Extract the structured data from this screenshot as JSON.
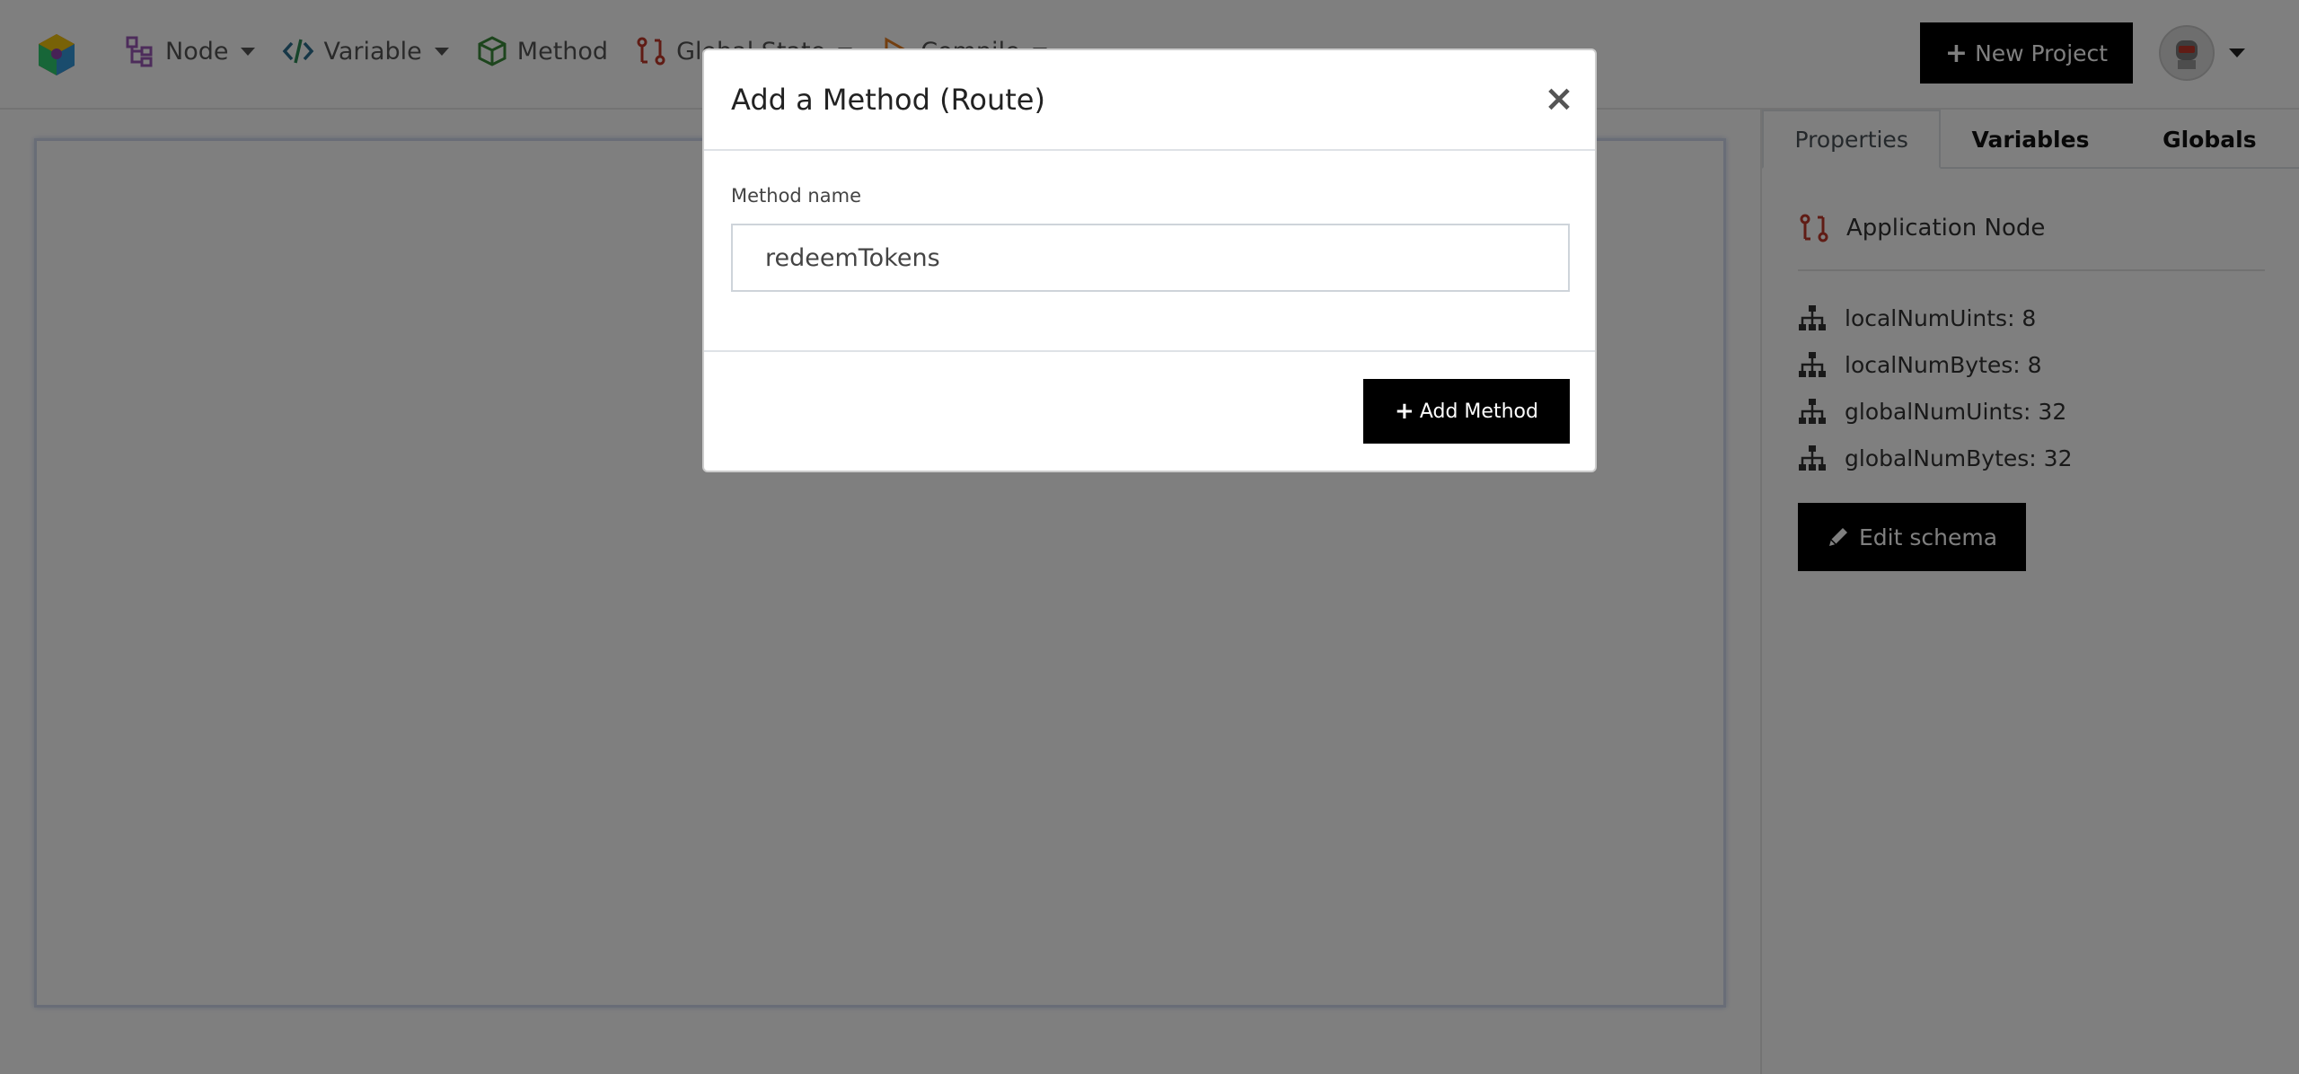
{
  "navbar": {
    "items": [
      {
        "label": "Node",
        "icon": "node-tree-icon",
        "has_caret": true
      },
      {
        "label": "Variable",
        "icon": "code-icon",
        "has_caret": true
      },
      {
        "label": "Method",
        "icon": "cube-icon",
        "has_caret": false
      },
      {
        "label": "Global State",
        "icon": "route-icon",
        "has_caret": true
      },
      {
        "label": "Compile",
        "icon": "play-icon",
        "has_caret": true
      }
    ],
    "new_project_label": "New Project",
    "colors": {
      "node": "#9b59b6",
      "variable": "#2c6e8f",
      "method": "#3a8a3a",
      "global": "#c0392b",
      "compile": "#e67e22"
    }
  },
  "panel": {
    "tabs": [
      {
        "label": "Properties",
        "active": true
      },
      {
        "label": "Variables",
        "active": false
      },
      {
        "label": "Globals",
        "active": false
      }
    ],
    "node_title": "Application Node",
    "schema": [
      {
        "label": "localNumUints: 8"
      },
      {
        "label": "localNumBytes: 8"
      },
      {
        "label": "globalNumUints: 32"
      },
      {
        "label": "globalNumBytes: 32"
      }
    ],
    "edit_schema_label": "Edit schema"
  },
  "modal": {
    "title": "Add a Method (Route)",
    "close_symbol": "×",
    "field_label": "Method name",
    "method_name_value": "redeemTokens",
    "submit_label": "Add Method"
  }
}
